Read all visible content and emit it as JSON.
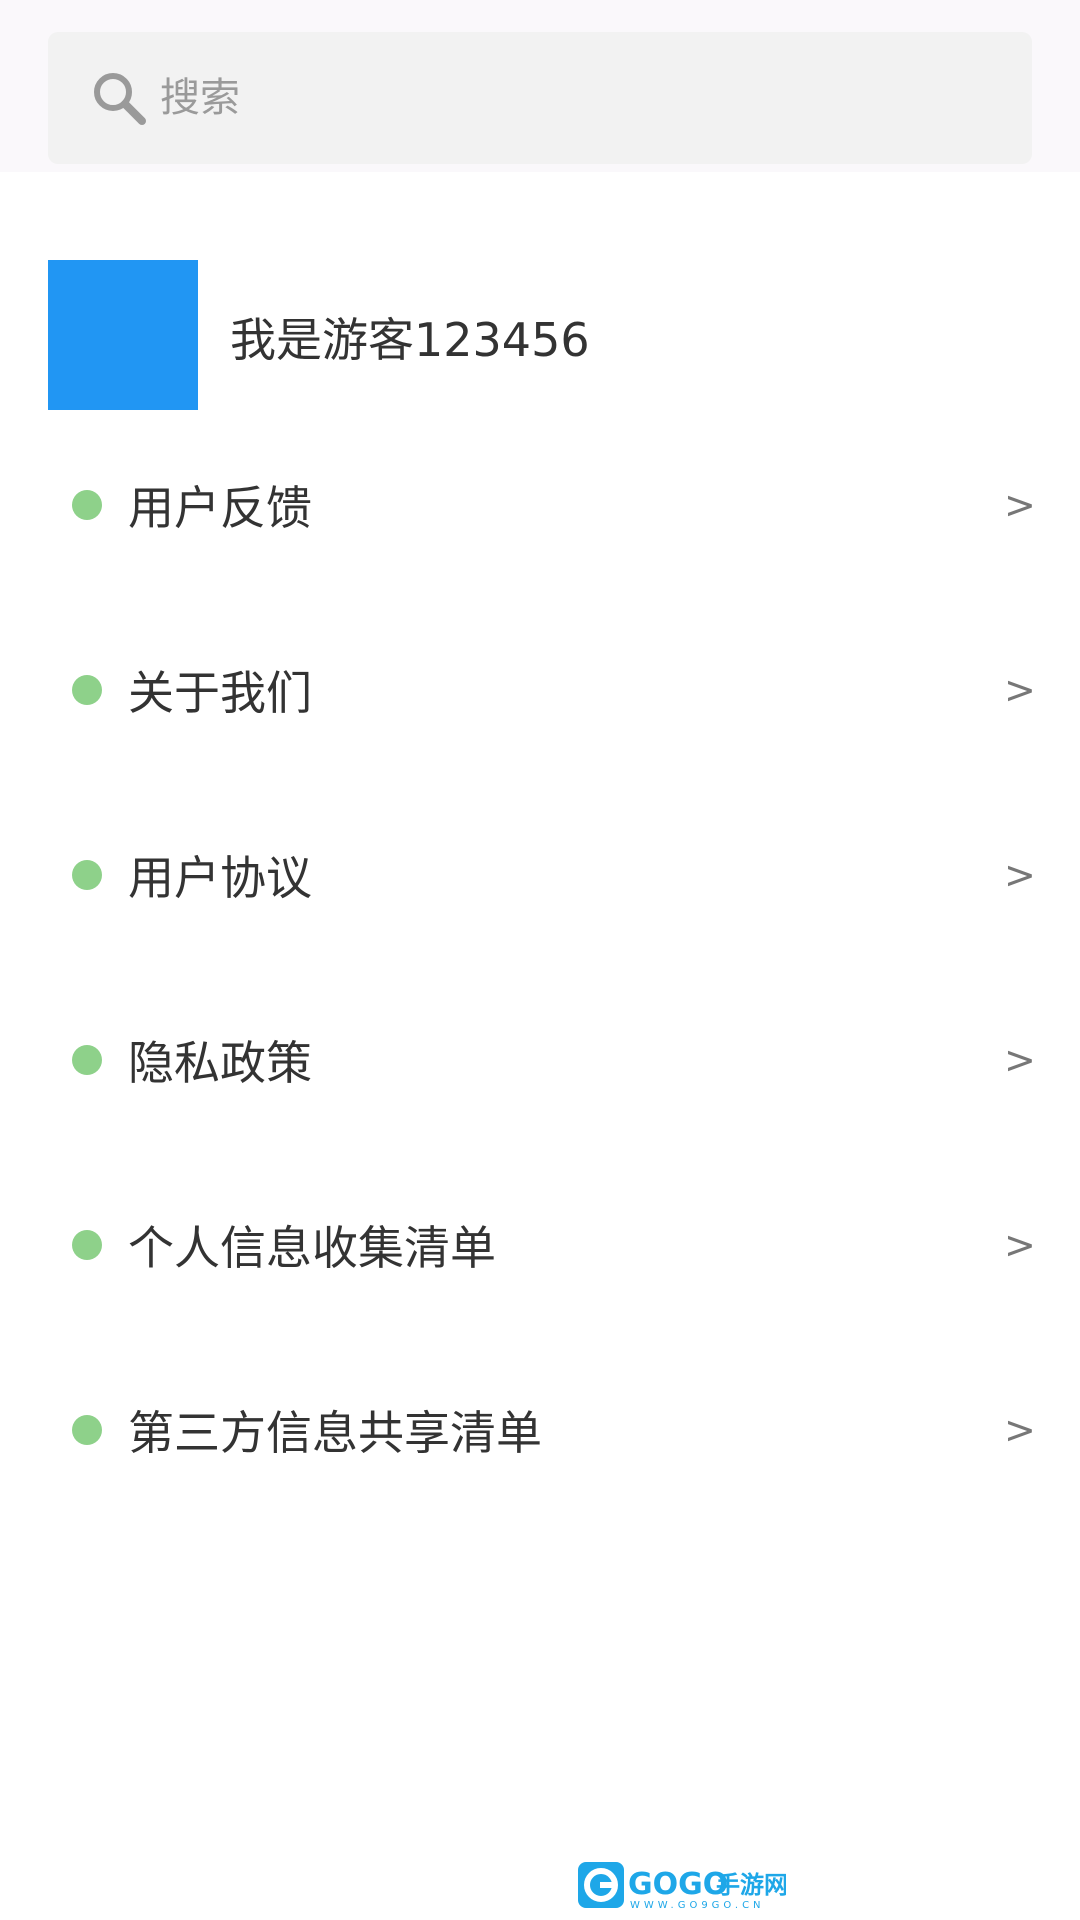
{
  "search": {
    "placeholder": "搜索"
  },
  "profile": {
    "username": "我是游客123456"
  },
  "menu": {
    "items": [
      {
        "label": "用户反馈",
        "chevron": ">"
      },
      {
        "label": "关于我们",
        "chevron": ">"
      },
      {
        "label": "用户协议",
        "chevron": ">"
      },
      {
        "label": "隐私政策",
        "chevron": ">"
      },
      {
        "label": "个人信息收集清单",
        "chevron": ">"
      },
      {
        "label": "第三方信息共享清单",
        "chevron": ">"
      }
    ]
  },
  "footer": {
    "logo_text": "GOGO手游网",
    "logo_sub": "WWW.GO9GO.CN"
  },
  "colors": {
    "accent_avatar": "#2196f3",
    "bullet": "#8ed18a",
    "search_bg": "#f2f2f2"
  }
}
